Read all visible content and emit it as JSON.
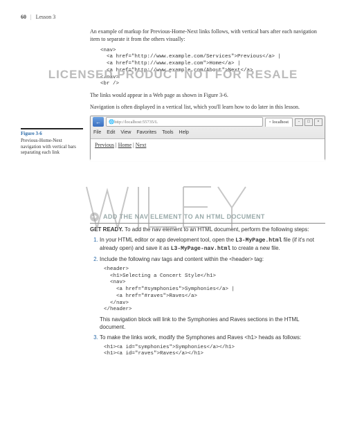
{
  "header": {
    "page_num": "60",
    "separator": "|",
    "lesson": "Lesson 3"
  },
  "intro1": "An example of markup for Previous-Home-Next links follows, with vertical bars after each navigation item to separate it from the others visually:",
  "code1": "<nav>\n  <a href=\"http://www.example.com/Services\">Previous</a> |\n  <a href=\"http://www.example.com\">Home</a> |\n  <a href=\"http://www.example.com/About\">Next</a>\n</nav>\n<br />",
  "watermark1": "LICENSED PRODUCT NOT FOR RESALE",
  "para2": "The links would appear in a Web page as shown in Figure 3-6.",
  "para3": "Navigation is often displayed in a vertical list, which you'll learn how to do later in this lesson.",
  "figure": {
    "title": "Figure 3-6",
    "caption": "Previous-Home-Next navigation with vertical bars separating each link"
  },
  "browser": {
    "url": "http://localhost:55735/L",
    "tab_label": "localhost",
    "menus": [
      "File",
      "Edit",
      "View",
      "Favorites",
      "Tools",
      "Help"
    ],
    "content_links": [
      "Previous",
      "Home",
      "Next"
    ]
  },
  "wiley_text": "WILEY",
  "section_title": "ADD THE NAV ELEMENT TO AN HTML DOCUMENT",
  "get_ready_label": "GET READY.",
  "get_ready_text": " To add the nav element to an HTML document, perform the following steps:",
  "steps": {
    "s1a": "In your HTML editor or app development tool, open the ",
    "s1_file1": "L3-MyPage.html",
    "s1b": " file (if it's not already open) and save it as ",
    "s1_file2": "L3-MyPage-nav.html",
    "s1c": " to create a new file.",
    "s2": "Include the following nav tags and content within the <header> tag:",
    "code2": "<header>\n  <h1>Selecting a Concert Style</h1>\n  <nav>\n    <a href=\"#symphonies\">Symphonies</a> |\n    <a href=\"#raves\">Raves</a>\n  </nav>\n</header>",
    "after2": "This navigation block will link to the Symphonies and Raves sections in the HTML document.",
    "s3": "To make the links work, modify the Symphones and Raves <h1> heads as follows:",
    "code3": "<h1><a id=\"symphonies\">Symphonies</a></h1>\n<h1><a id=\"raves\">Raves</a></h1>"
  }
}
